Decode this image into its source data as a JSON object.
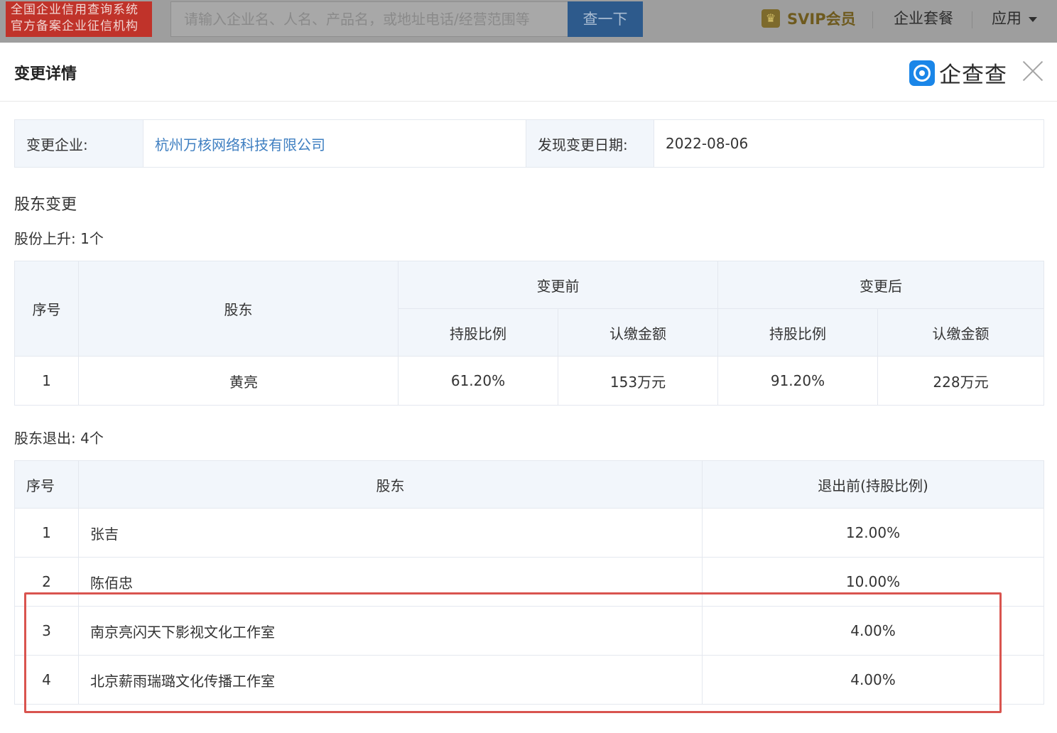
{
  "topbar": {
    "badge_line1": "全国企业信用查询系统",
    "badge_line2": "官方备案企业征信机构",
    "search_placeholder": "请输入企业名、人名、产品名，或地址电话/经营范围等",
    "search_button": "查一下",
    "svip_icon": "crown-icon",
    "svip_label": "SVIP会员",
    "nav_enterprise": "企业套餐",
    "nav_apps": "应用"
  },
  "modal": {
    "title": "变更详情",
    "logo_text": "企查查",
    "logo_icon": "qcc-logo-icon",
    "close_icon": "close-icon"
  },
  "info": {
    "company_label": "变更企业:",
    "company_value": "杭州万核网络科技有限公司",
    "date_label": "发现变更日期:",
    "date_value": "2022-08-06"
  },
  "section": {
    "title": "股东变更",
    "increase_label": "股份上升: 1个",
    "exit_label": "股东退出: 4个"
  },
  "increase_table": {
    "headers": {
      "index": "序号",
      "holder": "股东",
      "before": "变更前",
      "after": "变更后",
      "ratio": "持股比例",
      "amount": "认缴金额"
    },
    "rows": [
      {
        "index": "1",
        "holder": "黄亮",
        "before_ratio": "61.20%",
        "before_amount": "153万元",
        "after_ratio": "91.20%",
        "after_amount": "228万元"
      }
    ]
  },
  "exit_table": {
    "headers": {
      "index": "序号",
      "holder": "股东",
      "ratio_before_exit": "退出前(持股比例)"
    },
    "rows": [
      {
        "index": "1",
        "holder": "张吉",
        "ratio": "12.00%"
      },
      {
        "index": "2",
        "holder": "陈佰忠",
        "ratio": "10.00%"
      },
      {
        "index": "3",
        "holder": "南京亮闪天下影视文化工作室",
        "ratio": "4.00%"
      },
      {
        "index": "4",
        "holder": "北京薪雨瑞璐文化传播工作室",
        "ratio": "4.00%"
      }
    ]
  },
  "colors": {
    "link": "#3f7fc1",
    "highlight": "#d9544f",
    "header_bg": "#f2f6fb"
  }
}
